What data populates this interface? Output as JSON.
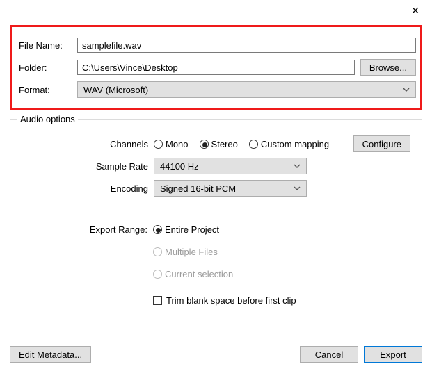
{
  "labels": {
    "file_name": "File Name:",
    "folder": "Folder:",
    "format": "Format:",
    "browse": "Browse...",
    "audio_options": "Audio options",
    "channels": "Channels",
    "sample_rate": "Sample Rate",
    "encoding": "Encoding",
    "export_range": "Export Range:",
    "configure": "Configure",
    "edit_metadata": "Edit Metadata...",
    "cancel": "Cancel",
    "export": "Export"
  },
  "values": {
    "file_name": "samplefile.wav",
    "folder": "C:\\Users\\Vince\\Desktop",
    "format": "WAV (Microsoft)",
    "sample_rate": "44100 Hz",
    "encoding": "Signed 16-bit PCM"
  },
  "channels": {
    "mono": "Mono",
    "stereo": "Stereo",
    "custom": "Custom mapping",
    "selected": "stereo"
  },
  "export_range": {
    "entire": "Entire Project",
    "multiple": "Multiple Files",
    "current": "Current selection",
    "selected": "entire"
  },
  "trim": {
    "label": "Trim blank space before first clip",
    "checked": false
  }
}
